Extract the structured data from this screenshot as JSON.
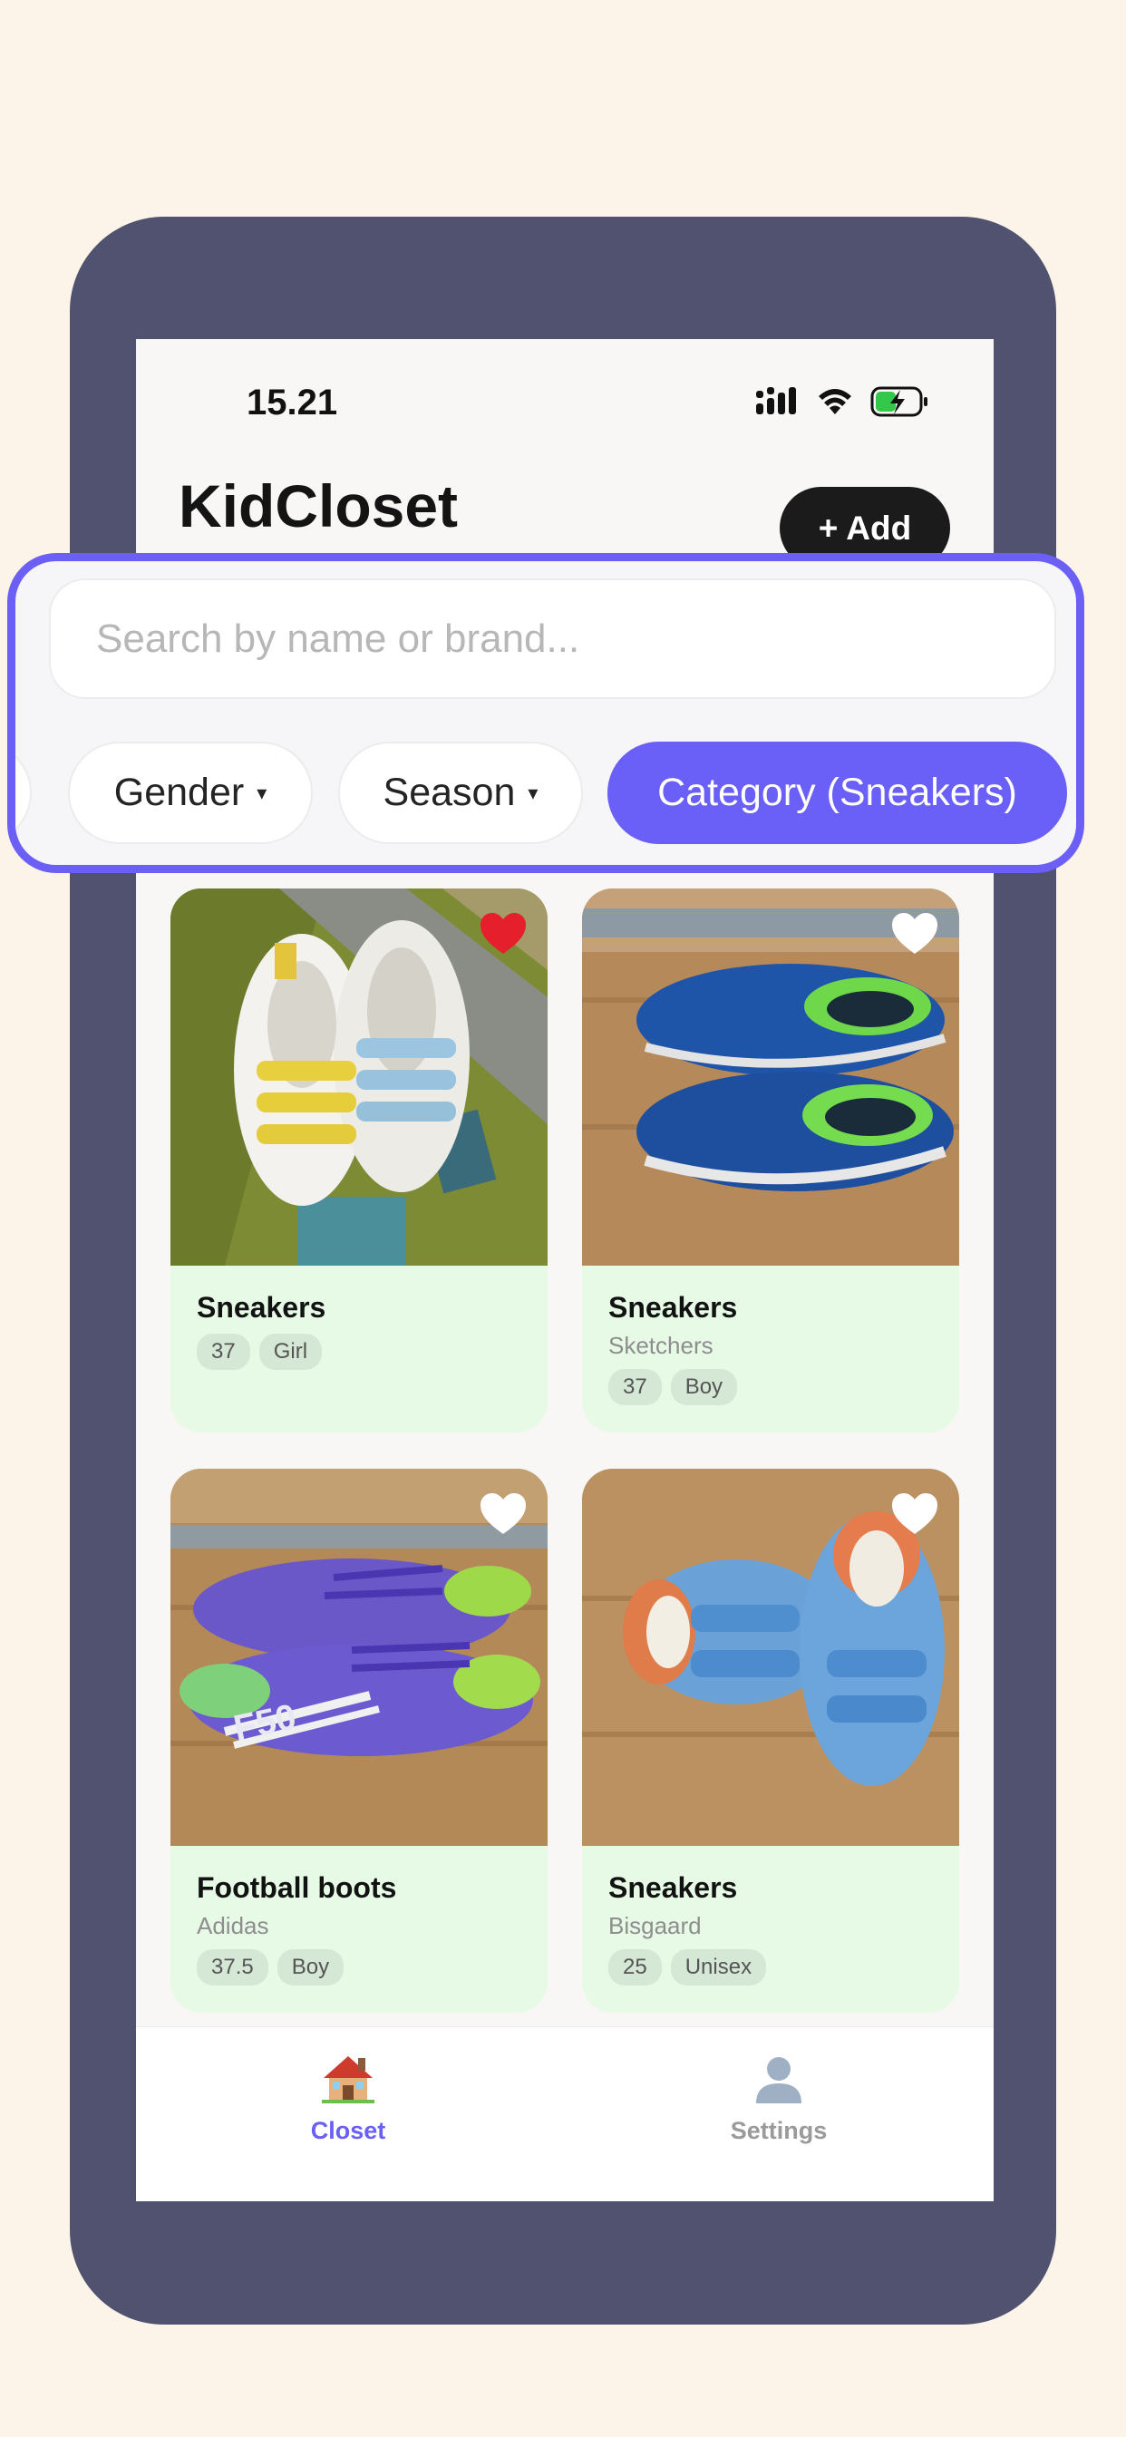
{
  "status_bar": {
    "time": "15.21"
  },
  "header": {
    "title": "KidCloset",
    "add_label": "+ Add"
  },
  "search": {
    "placeholder": "Search by name or brand..."
  },
  "filters": [
    {
      "label": "Gender",
      "caret": "▾",
      "active": false
    },
    {
      "label": "Season",
      "caret": "▾",
      "active": false
    },
    {
      "label": "Category (Sneakers)",
      "active": true
    }
  ],
  "items": [
    {
      "name": "Sneakers",
      "brand": "",
      "tags": [
        "37",
        "Girl"
      ],
      "favorite": true,
      "photo": "white-sneakers-on-rug"
    },
    {
      "name": "Sneakers",
      "brand": "Sketchers",
      "tags": [
        "37",
        "Boy"
      ],
      "favorite": false,
      "photo": "blue-sneakers-on-floor"
    },
    {
      "name": "Football boots",
      "brand": "Adidas",
      "tags": [
        "37.5",
        "Boy"
      ],
      "favorite": false,
      "photo": "purple-football-boots"
    },
    {
      "name": "Sneakers",
      "brand": "Bisgaard",
      "tags": [
        "25",
        "Unisex"
      ],
      "favorite": false,
      "photo": "light-blue-sneakers"
    }
  ],
  "tabs": [
    {
      "label": "Closet",
      "icon": "house-icon",
      "active": true
    },
    {
      "label": "Settings",
      "icon": "person-silhouette-icon",
      "active": false
    }
  ],
  "colors": {
    "background": "#fcf4e8",
    "device": "#50526f",
    "accent": "#6a5ff6",
    "card": "#e6fae6",
    "favorite": "#e51f2b"
  }
}
